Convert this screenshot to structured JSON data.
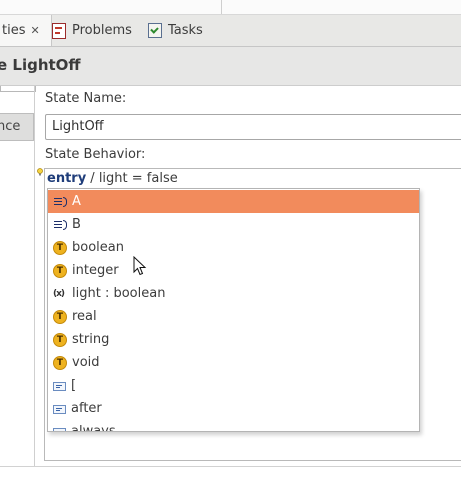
{
  "tabs": [
    {
      "label": "ties",
      "close": "✕"
    },
    {
      "label": "Problems"
    },
    {
      "label": "Tasks"
    }
  ],
  "header": {
    "title": "e LightOff"
  },
  "left": {
    "tab_label": "nce"
  },
  "form": {
    "state_name_label": "State Name:",
    "state_name_value": "LightOff",
    "state_behavior_label": "State Behavior:",
    "behavior_keyword": "entry",
    "behavior_rest": " / light = false"
  },
  "completion": {
    "items": [
      {
        "label": "A",
        "icon": "list-icon",
        "selected": true
      },
      {
        "label": "B",
        "icon": "list-icon"
      },
      {
        "label": "boolean",
        "icon": "type-icon"
      },
      {
        "label": "integer",
        "icon": "type-icon"
      },
      {
        "label": "light : boolean",
        "icon": "variable-icon"
      },
      {
        "label": "real",
        "icon": "type-icon"
      },
      {
        "label": "string",
        "icon": "type-icon"
      },
      {
        "label": "void",
        "icon": "type-icon"
      },
      {
        "label": "[",
        "icon": "keyword-icon"
      },
      {
        "label": "after",
        "icon": "keyword-icon"
      },
      {
        "label": "always",
        "icon": "keyword-icon"
      }
    ]
  },
  "colors": {
    "selection": "#f28b5c",
    "keyword": "#1f3d7a",
    "type_icon": "#eeb21f"
  }
}
